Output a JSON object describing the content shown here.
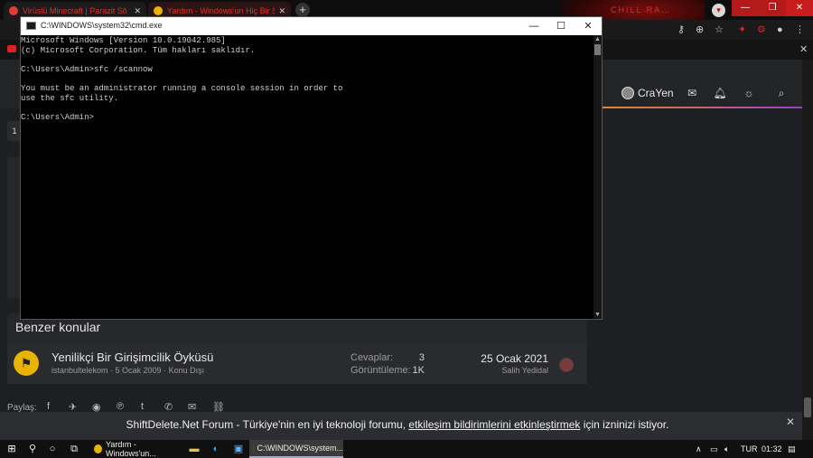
{
  "browser": {
    "tabs": [
      {
        "title": "Virüslü Minecraft | Parazit Sö",
        "close": "✕",
        "favicon_color": "#e53935"
      },
      {
        "title": "Yardım - Windows'un Hiç Bir Şey",
        "close": "✕",
        "favicon_color": "#e8b400"
      }
    ],
    "new_tab": "+",
    "bookmark_text": "CHILL RA…",
    "window_controls": {
      "min": "—",
      "max": "❐",
      "close": "✕"
    }
  },
  "site_header": {
    "username": "CraYen"
  },
  "page_chip": "1",
  "similar_threads": {
    "title": "Benzer konular",
    "items": [
      {
        "title": "Yenilikçi Bir Girişimcilik Öyküsü",
        "meta": "istanbultelekom · 5 Ocak 2009 · Konu Dışı",
        "replies_label": "Cevaplar:",
        "replies": "3",
        "views_label": "Görüntüleme:",
        "views": "1K",
        "last_date": "25 Ocak 2021",
        "last_user": "Salih Yedidal"
      }
    ]
  },
  "share_label": "Paylaş:",
  "consent": {
    "text_before": "ShiftDelete.Net Forum - Türkiye'nin en iyi teknoloji forumu,",
    "link": "etkileşim bildirimlerini etkinleştirmek",
    "text_after": "için izninizi istiyor.",
    "close": "✕"
  },
  "cmd": {
    "title": "C:\\WINDOWS\\system32\\cmd.exe",
    "lines": [
      "Microsoft Windows [Version 10.0.19042.985]",
      "(c) Microsoft Corporation. Tüm hakları saklıdır.",
      "",
      "C:\\Users\\Admin>sfc /scannow",
      "",
      "You must be an administrator running a console session in order to",
      "use the sfc utility.",
      "",
      "C:\\Users\\Admin>"
    ]
  },
  "taskbar": {
    "apps": [
      {
        "label": "Yardım - Windows'un...",
        "color": "#e8b400"
      },
      {
        "label": "C:\\WINDOWS\\system...",
        "color": "#444"
      }
    ],
    "language": "TUR",
    "time": "01:32"
  }
}
